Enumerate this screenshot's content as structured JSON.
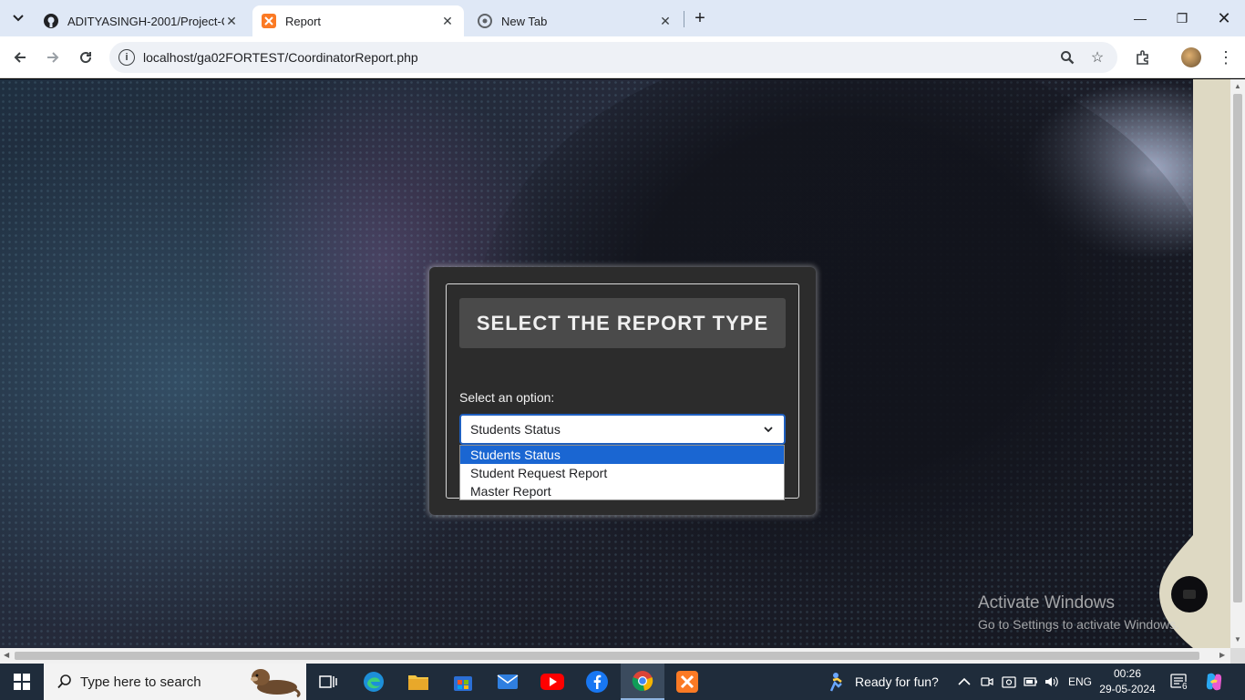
{
  "browser": {
    "tabs": [
      {
        "title": "ADITYASINGH-2001/Project-Ca",
        "icon": "github-icon",
        "active": false
      },
      {
        "title": "Report",
        "icon": "xampp-icon",
        "active": true
      },
      {
        "title": "New Tab",
        "icon": "chrome-icon",
        "active": false
      }
    ],
    "url": "localhost/ga02FORTEST/CoordinatorReport.php"
  },
  "report": {
    "heading": "SELECT THE REPORT TYPE",
    "select_label": "Select an option:",
    "selected_value": "Students Status",
    "options": [
      "Students Status",
      "Student Request Report",
      "Master Report"
    ]
  },
  "watermark": {
    "line1": "Activate Windows",
    "line2": "Go to Settings to activate Windows."
  },
  "taskbar": {
    "search_placeholder": "Type here to search",
    "weather_text": "Ready for fun?",
    "language": "ENG",
    "time": "00:26",
    "date": "29-05-2024",
    "notification_count": "6"
  },
  "colors": {
    "select_highlight": "#1a66d2",
    "card_bg": "#2c2c2c",
    "heading_bg": "#4a4a4a",
    "taskbar_bg": "#1f2c3b"
  }
}
